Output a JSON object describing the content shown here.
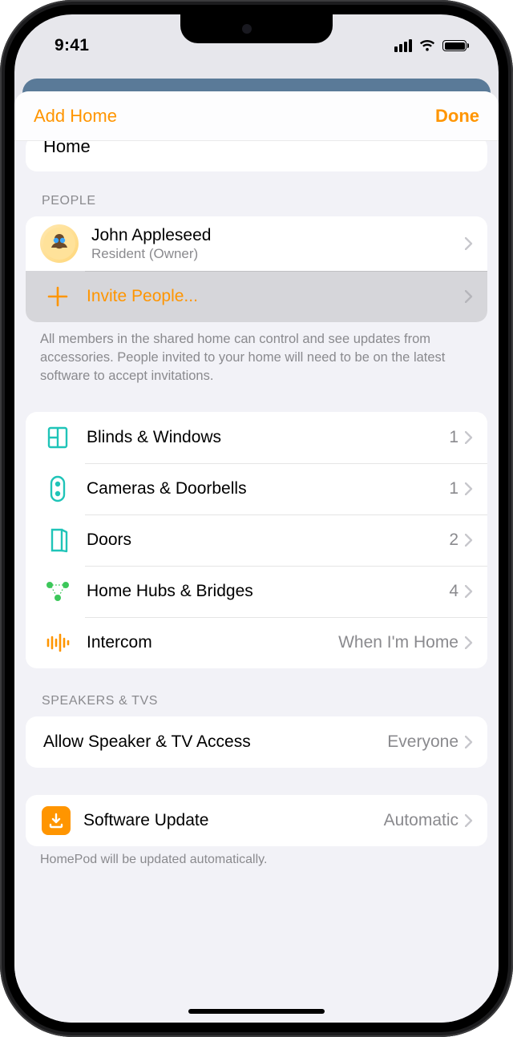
{
  "status": {
    "time": "9:41"
  },
  "nav": {
    "left": "Add Home",
    "right": "Done"
  },
  "home_card": {
    "title": "Home"
  },
  "people": {
    "header": "PEOPLE",
    "member": {
      "name": "John Appleseed",
      "role": "Resident (Owner)"
    },
    "invite_label": "Invite People...",
    "footer": "All members in the shared home can control and see updates from accessories. People invited to your home will need to be on the latest software to accept invitations."
  },
  "categories": [
    {
      "label": "Blinds & Windows",
      "value": "1"
    },
    {
      "label": "Cameras & Doorbells",
      "value": "1"
    },
    {
      "label": "Doors",
      "value": "2"
    },
    {
      "label": "Home Hubs & Bridges",
      "value": "4"
    },
    {
      "label": "Intercom",
      "value": "When I'm Home"
    }
  ],
  "speakers": {
    "header": "SPEAKERS & TVS",
    "row_label": "Allow Speaker & TV Access",
    "row_value": "Everyone"
  },
  "software": {
    "label": "Software Update",
    "value": "Automatic",
    "footer": "HomePod will be updated automatically."
  }
}
